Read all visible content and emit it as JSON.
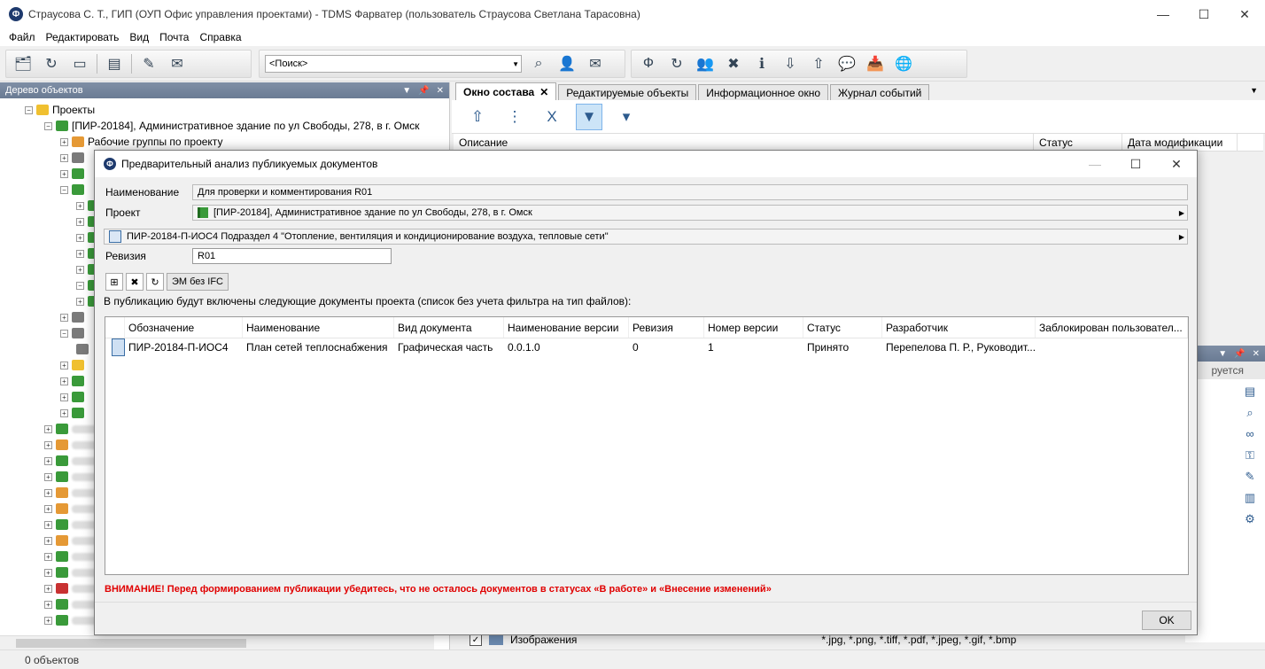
{
  "app": {
    "title": "Страусова С. Т., ГИП (ОУП Офис управления проектами) - TDMS Фарватер (пользователь Страусова Светлана Тарасовна)",
    "icon_letter": "Ф"
  },
  "menu": [
    "Файл",
    "Редактировать",
    "Вид",
    "Почта",
    "Справка"
  ],
  "search": {
    "placeholder": "<Поиск>"
  },
  "left_panel": {
    "title": "Дерево объектов",
    "tree": {
      "projects_label": "Проекты",
      "project_label": "[ПИР-20184], Административное здание по ул Свободы, 278, в г. Омск",
      "workgroups_label": "Рабочие группы по проекту"
    }
  },
  "right_panel": {
    "tabs": [
      "Окно состава",
      "Редактируемые объекты",
      "Информационное окно",
      "Журнал событий"
    ],
    "columns": [
      "Описание",
      "Статус",
      "Дата модификации"
    ],
    "lower_header_text": "руется",
    "images_row": {
      "label": "Изображения",
      "extensions": "*.jpg, *.png, *.tiff, *.pdf, *.jpeg, *.gif, *.bmp"
    }
  },
  "status": {
    "text": "0 объектов"
  },
  "dialog": {
    "title": "Предварительный анализ публикуемых документов",
    "name_label": "Наименование",
    "name_value": "Для проверки и комментирования R01",
    "project_label": "Проект",
    "project_value": "[ПИР-20184], Административное здание по ул Свободы, 278, в г. Омск",
    "section_value": "ПИР-20184-П-ИОС4 Подраздел 4 \"Отопление, вентиляция и кондиционирование воздуха, тепловые сети\"",
    "revision_label": "Ревизия",
    "revision_value": "R01",
    "em_button": "ЭМ без IFC",
    "info_text": "В публикацию будут включены следующие документы проекта (список без учета фильтра на тип файлов):",
    "columns": [
      "Обозначение",
      "Наименование",
      "Вид документа",
      "Наименование версии",
      "Ревизия",
      "Номер версии",
      "Статус",
      "Разработчик",
      "Заблокирован пользовател..."
    ],
    "rows": [
      [
        "ПИР-20184-П-ИОС4",
        "План сетей теплоснабжения",
        "Графическая часть",
        "0.0.1.0",
        "0",
        "1",
        "Принято",
        "Перепелова П. Р., Руководит...",
        ""
      ]
    ],
    "warning": "ВНИМАНИЕ! Перед формированием публикации убедитесь, что не осталось документов в статусах «В работе» и «Внесение изменений»",
    "ok_label": "OK"
  },
  "colors": {
    "warning": "#e00000",
    "panel_header": "#6a7b94",
    "selection": "#cce4f7"
  }
}
